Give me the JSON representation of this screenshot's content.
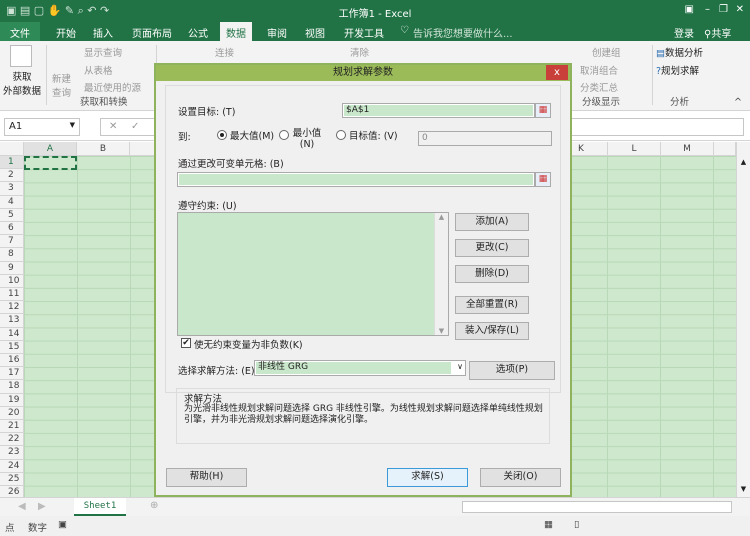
{
  "window": {
    "title": "工作簿1 - Excel",
    "controls": [
      "▣",
      "–",
      "❐",
      "✕"
    ]
  },
  "tabs": {
    "file": "文件",
    "items": [
      "开始",
      "插入",
      "页面布局",
      "公式",
      "数据",
      "审阅",
      "视图",
      "开发工具"
    ],
    "active": "数据",
    "tell_me": "告诉我您想要做什么...",
    "login": "登录",
    "share": "共享"
  },
  "ribbon": {
    "get_external": [
      "获取",
      "外部数据"
    ],
    "new_query": [
      "新建",
      "查询"
    ],
    "show_queries": "显示查询",
    "from_table": "从表格",
    "recent_sources": "最近使用的源",
    "group_get_transform": "获取和转换",
    "connections": "连接",
    "clear": "清除",
    "create_group": "创建组",
    "ungroup": "取消组合",
    "subtotal": "分类汇总",
    "group_outline": "分级显示",
    "data_analysis": "数据分析",
    "solver": "规划求解",
    "group_analysis": "分析"
  },
  "formula_bar": {
    "name_box": "A1",
    "cancel": "✕",
    "enter": "✓",
    "value": ""
  },
  "grid": {
    "columns": [
      "A",
      "B",
      "K",
      "L",
      "M"
    ],
    "rows": [
      "1",
      "2",
      "3",
      "4",
      "5",
      "6",
      "7",
      "8",
      "9",
      "10",
      "11",
      "12",
      "13",
      "14",
      "15",
      "16",
      "17",
      "18",
      "19",
      "20",
      "21",
      "22",
      "23",
      "24",
      "25",
      "26"
    ]
  },
  "sheet_tabs": {
    "sheets": [
      "Sheet1"
    ],
    "active": "Sheet1"
  },
  "status_bar": {
    "mode": "点",
    "num": "数字"
  },
  "dialog": {
    "title": "规划求解参数",
    "close": "x",
    "set_objective_label": "设置目标: (T)",
    "set_objective_value": "$A$1",
    "to_label": "到:",
    "options": [
      {
        "label": "最大值(M)",
        "selected": true
      },
      {
        "label": "最小值(N)",
        "selected": false
      },
      {
        "label": "目标值: (V)",
        "selected": false
      }
    ],
    "value_of": "0",
    "changing_cells_label": "通过更改可变单元格: (B)",
    "changing_cells_value": "",
    "constraints_label": "遵守约束: (U)",
    "constraint_buttons": [
      "添加(A)",
      "更改(C)",
      "删除(D)",
      "全部重置(R)",
      "装入/保存(L)"
    ],
    "nonneg_label": "使无约束变量为非负数(K)",
    "nonneg_checked": true,
    "method_label": "选择求解方法: (E)",
    "method_value": "非线性 GRG",
    "options_button": "选项(P)",
    "method_group_title": "求解方法",
    "method_description": "为光滑非线性规划求解问题选择 GRG 非线性引擎。为线性规划求解问题选择单纯线性规划引擎，并为非光滑规划求解问题选择演化引擎。",
    "help_button": "帮助(H)",
    "solve_button": "求解(S)",
    "close_button": "关闭(O)"
  }
}
